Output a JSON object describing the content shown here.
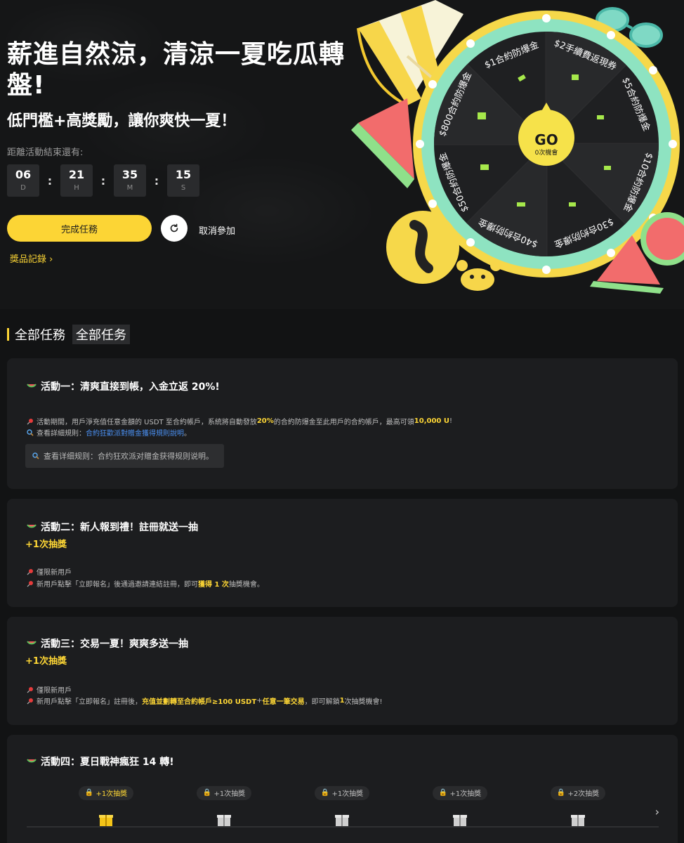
{
  "hero": {
    "title": "薪進自然涼，清涼一夏吃瓜轉盤!",
    "subtitle": "低門檻+高獎勵，讓你爽快一夏！",
    "countdown_label": "距離活動結束還有:",
    "countdown": [
      {
        "value": "06",
        "unit": "D"
      },
      {
        "value": "21",
        "unit": "H"
      },
      {
        "value": "35",
        "unit": "M"
      },
      {
        "value": "15",
        "unit": "S"
      }
    ],
    "primary_button": "完成任務",
    "cancel_label": "取消參加",
    "records_label": "獎品記錄 ›"
  },
  "wheel": {
    "go_label": "GO",
    "chances_label": "0次機會",
    "segments": [
      "$1合約防爆金",
      "$2手續費返現券",
      "$5合約防爆金",
      "$10合約防爆金",
      "$30合約防爆金",
      "$40合約防爆金",
      "$50合約防爆金",
      "$800合約防爆金"
    ]
  },
  "section": {
    "title": "全部任務",
    "tag": "全部任务"
  },
  "activities": [
    {
      "title": "活動一：清爽直接到帳，入金立返 20%!",
      "note1_pre": "活動期間，用戶淨充值任意金額的 USDT 至合約帳戶，系統將自動發放 ",
      "note1_hl1": "20%",
      "note1_mid": " 的合約防爆金至此用戶的合約帳戶，最高可領 ",
      "note1_hl2": "10,000 U",
      "note1_end": "!",
      "note2_pre": "查看詳細規則：",
      "note2_link": "合約狂歡派對贈金獲得規則說明",
      "note2_end": "。",
      "rule_box": "查看详细规则：合约狂欢派对赠金获得规则说明。"
    },
    {
      "title": "活動二：新人報到禮！註冊就送一抽",
      "reward": "+1次抽獎",
      "note1": "僅限新用戶",
      "note2_pre": "新用戶點擊「立即報名」後通過邀請連結註冊，即可",
      "note2_hl": "獲得 1 次",
      "note2_end": "抽獎機會。"
    },
    {
      "title": "活動三：交易一夏！爽爽多送一抽",
      "reward": "+1次抽獎",
      "note1": "僅限新用戶",
      "note2_pre": "新用戶點擊「立即報名」註冊後，",
      "note2_hl1": "充值並劃轉至合約帳戶≥100 USDT",
      "note2_mid": " + ",
      "note2_hl2": "任意一筆交易",
      "note2_mid2": "，即可解鎖 ",
      "note2_hl3": "1",
      "note2_end": " 次抽獎機會!"
    },
    {
      "title": "活動四：夏日戰神瘋狂 14 轉!",
      "steps": [
        "+1次抽獎",
        "+1次抽獎",
        "+1次抽獎",
        "+1次抽獎",
        "+2次抽獎"
      ],
      "next_arrow": "›"
    }
  ],
  "colors": {
    "accent": "#fcd535",
    "link": "#4a8ff0",
    "background": "#121314",
    "card": "#1c1d1f"
  }
}
